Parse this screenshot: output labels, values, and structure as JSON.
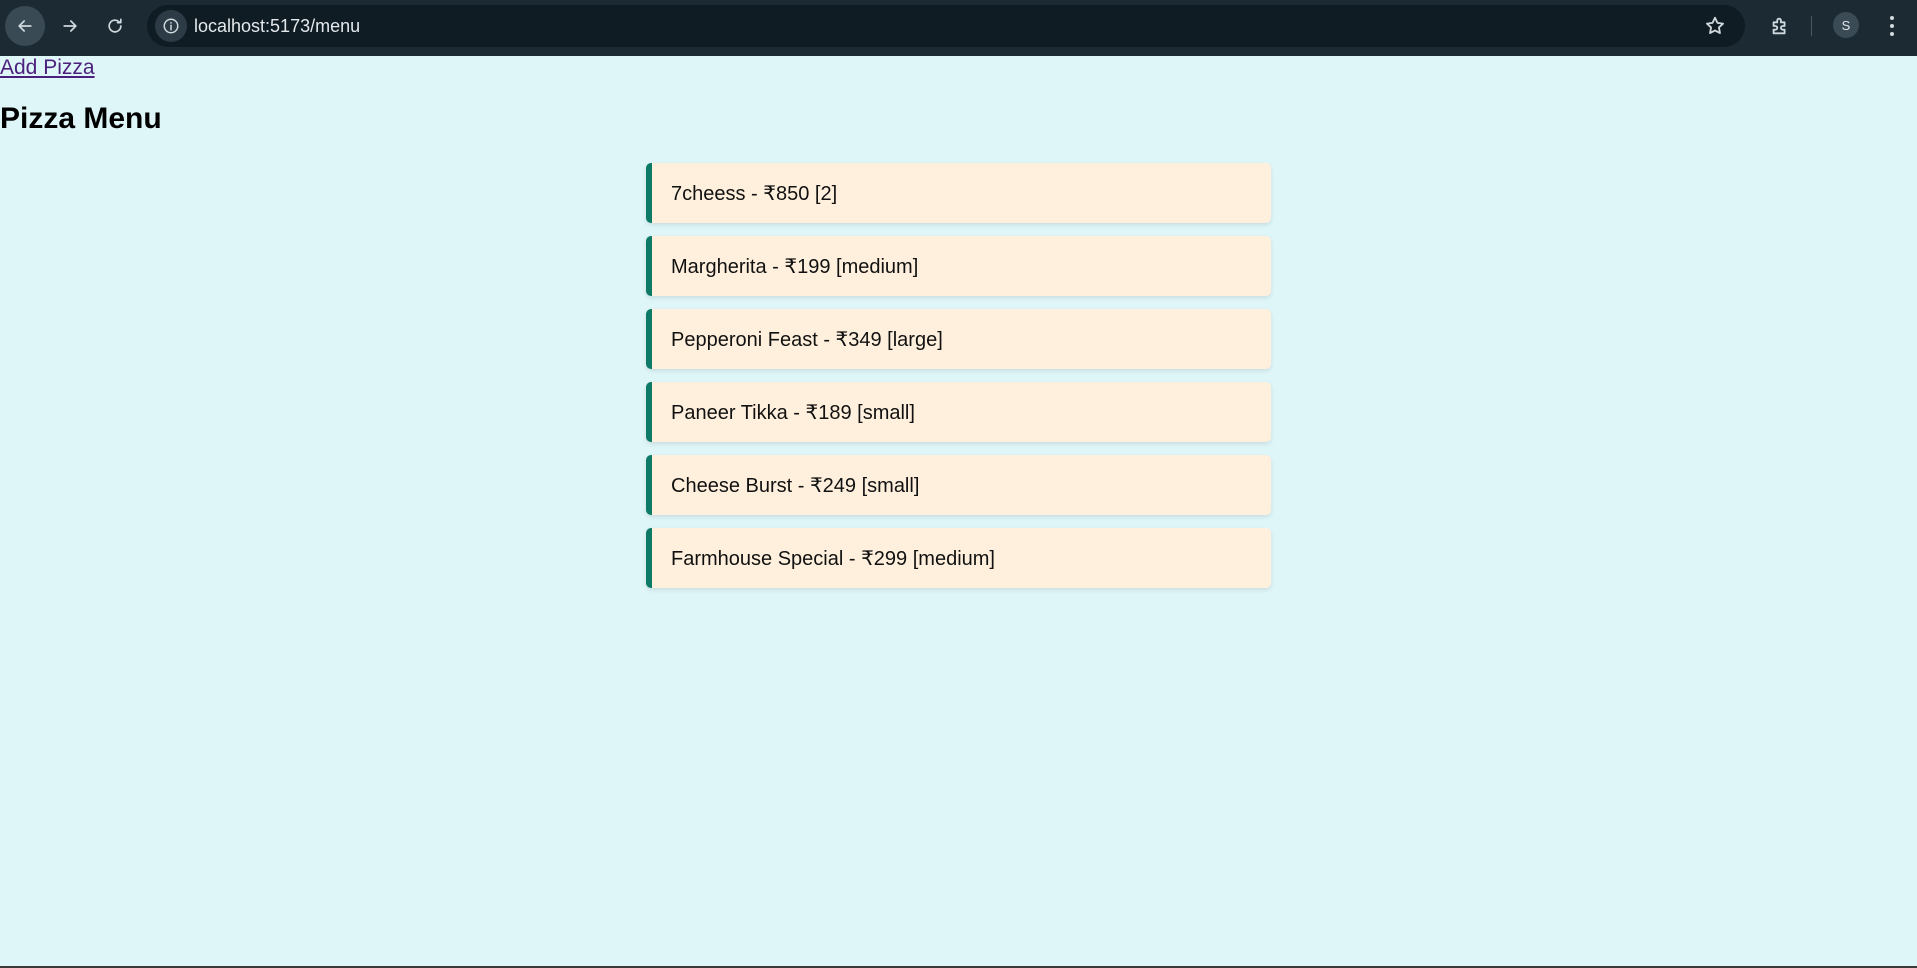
{
  "browser": {
    "url": "localhost:5173/menu",
    "profile_initial": "S"
  },
  "page": {
    "add_link": "Add Pizza",
    "title": "Pizza Menu"
  },
  "menu_items": [
    {
      "label": "7cheess - ₹850 [2]"
    },
    {
      "label": "Margherita - ₹199 [medium]"
    },
    {
      "label": "Pepperoni Feast - ₹349 [large]"
    },
    {
      "label": "Paneer Tikka - ₹189 [small]"
    },
    {
      "label": "Cheese Burst - ₹249 [small]"
    },
    {
      "label": "Farmhouse Special - ₹299 [medium]"
    }
  ],
  "icons": {
    "back": "arrow-left-icon",
    "forward": "arrow-right-icon",
    "reload": "reload-icon",
    "site_info": "info-icon",
    "bookmark": "star-icon",
    "extensions": "puzzle-icon",
    "menu": "kebab-menu-icon"
  },
  "colors": {
    "page_background": "#dff6f8",
    "item_background": "#fff0dd",
    "item_accent": "#0d7a68",
    "link": "#4b1f7c",
    "chrome": "#1b2a33"
  }
}
